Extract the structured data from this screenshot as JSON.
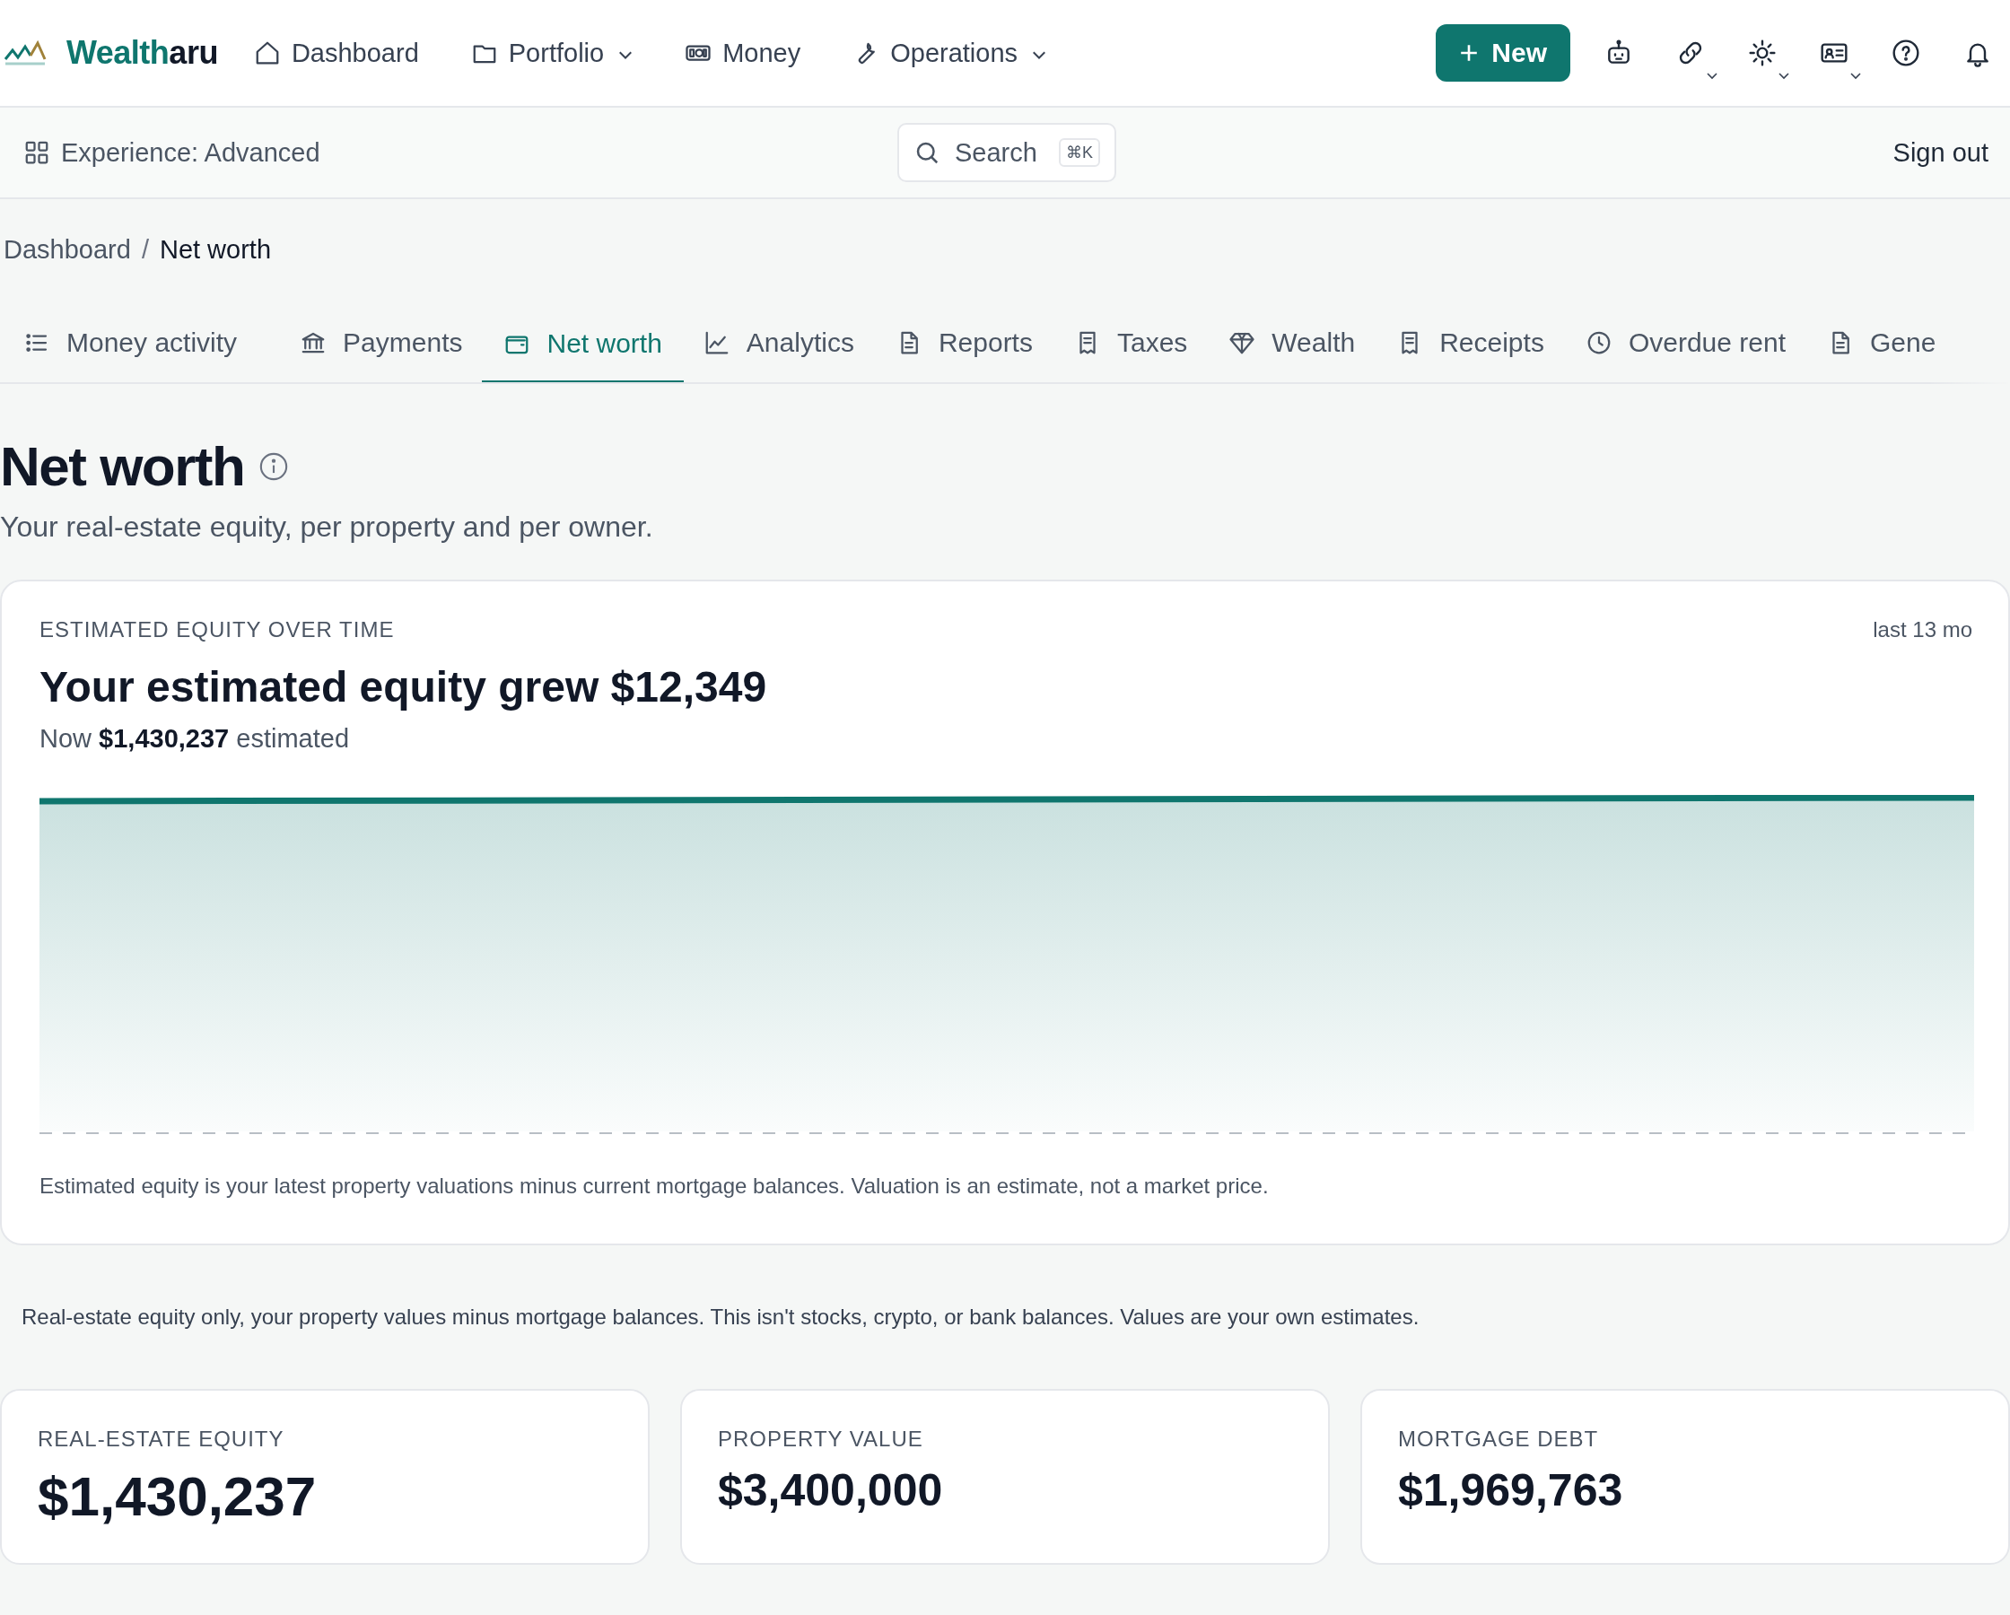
{
  "nav": {
    "brand": {
      "lead": "Wealth",
      "tail": "aru"
    },
    "links": [
      {
        "label": "Dashboard",
        "dropdown": false
      },
      {
        "label": "Portfolio",
        "dropdown": true
      },
      {
        "label": "Money",
        "dropdown": false
      },
      {
        "label": "Operations",
        "dropdown": true
      }
    ],
    "new_button": "New",
    "tools": [
      {
        "dropdown": false
      },
      {
        "dropdown": true
      },
      {
        "dropdown": true
      },
      {
        "dropdown": true
      },
      {
        "dropdown": false
      },
      {
        "dropdown": false
      }
    ]
  },
  "subbar": {
    "experience": "Experience: Advanced",
    "search": {
      "placeholder": "Search",
      "shortcut": "⌘K"
    },
    "sign_out": "Sign out"
  },
  "breadcrumb": {
    "items": [
      "Dashboard",
      "Net worth"
    ],
    "separator": "/"
  },
  "tabs": [
    {
      "label": "Money activity",
      "selected": false
    },
    {
      "label": "Payments",
      "selected": false
    },
    {
      "label": "Net worth",
      "selected": true
    },
    {
      "label": "Analytics",
      "selected": false
    },
    {
      "label": "Reports",
      "selected": false
    },
    {
      "label": "Taxes",
      "selected": false
    },
    {
      "label": "Wealth",
      "selected": false
    },
    {
      "label": "Receipts",
      "selected": false
    },
    {
      "label": "Overdue rent",
      "selected": false
    },
    {
      "label": "Gene",
      "selected": false
    }
  ],
  "page": {
    "title": "Net worth",
    "subtitle": "Your real-estate equity, per property and per owner."
  },
  "equity_card": {
    "eyebrow": "ESTIMATED EQUITY OVER TIME",
    "range": "last 13 mo",
    "headline": "Your estimated equity grew $12,349",
    "now": "Now **$1,430,237** estimated",
    "footnote": "Estimated equity is your latest property valuations minus current mortgage balances. Valuation is an estimate, not a market price."
  },
  "disclaimer": "Real-estate equity only, your property values minus mortgage balances. This isn't stocks, crypto, or bank balances. Values are your own estimates.",
  "stats": [
    {
      "label": "REAL-ESTATE EQUITY",
      "value": "$1,430,237",
      "kind": "primary"
    },
    {
      "label": "PROPERTY VALUE",
      "value": "$3,400,000",
      "kind": "secondary"
    },
    {
      "label": "MORTGAGE DEBT",
      "value": "$1,969,763",
      "kind": "secondary"
    }
  ]
}
